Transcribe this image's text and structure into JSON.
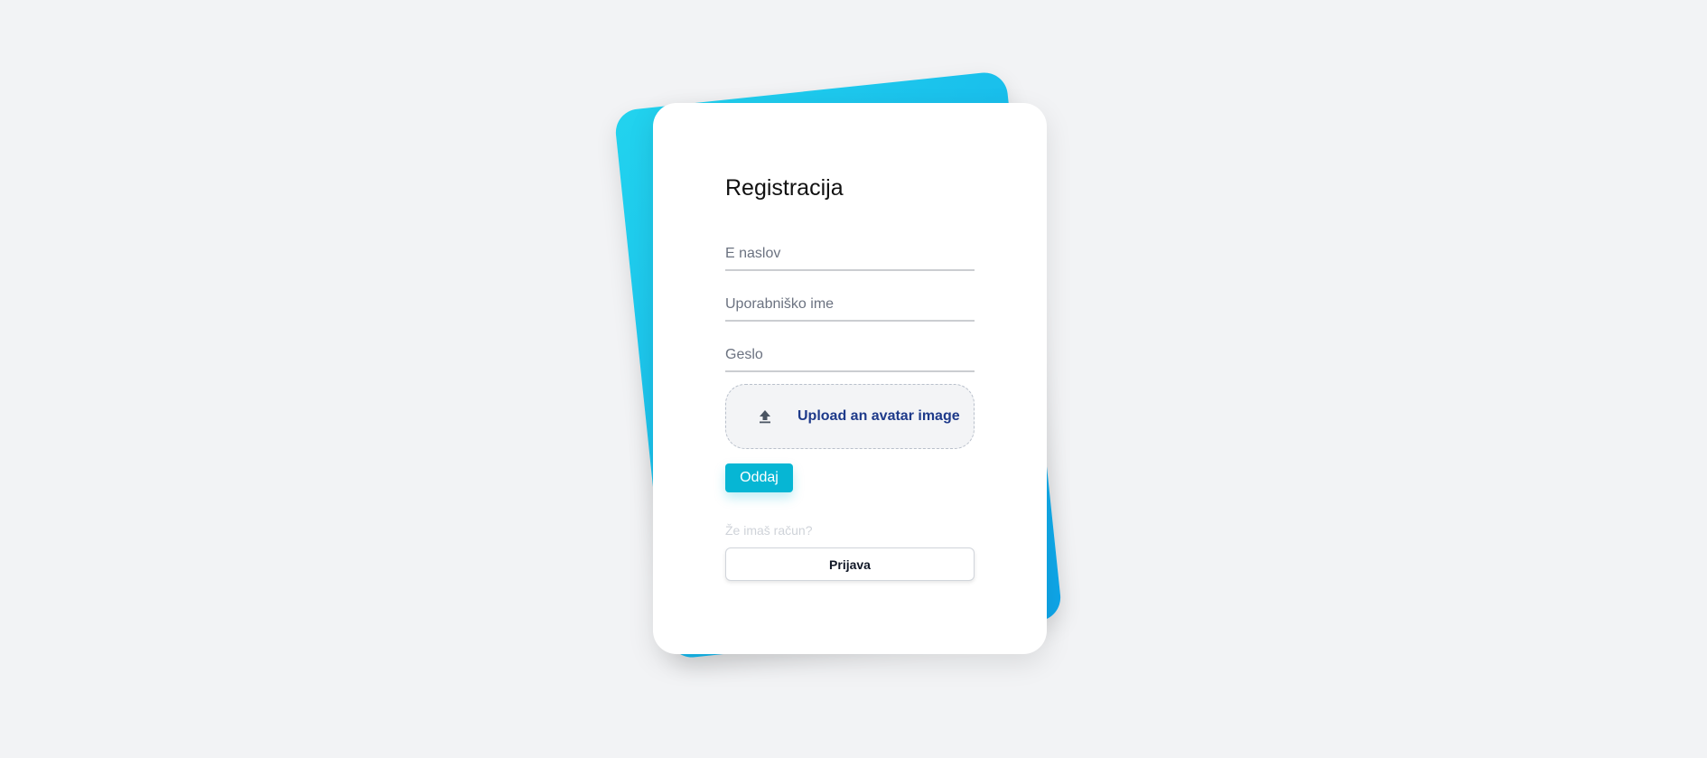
{
  "form": {
    "title": "Registracija",
    "email_placeholder": "E naslov",
    "username_placeholder": "Uporabniško ime",
    "password_placeholder": "Geslo",
    "upload_label": "Upload an avatar image",
    "upload_icon": "upload-icon",
    "submit_label": "Oddaj",
    "login_hint": "Že imaš račun?",
    "login_label": "Prijava"
  },
  "colors": {
    "background": "#f2f3f5",
    "back_card_gradient_start": "#22d3ee",
    "back_card_gradient_end": "#0ea5e9",
    "submit_button": "#06b6d4",
    "upload_text": "#1e3a8a"
  }
}
